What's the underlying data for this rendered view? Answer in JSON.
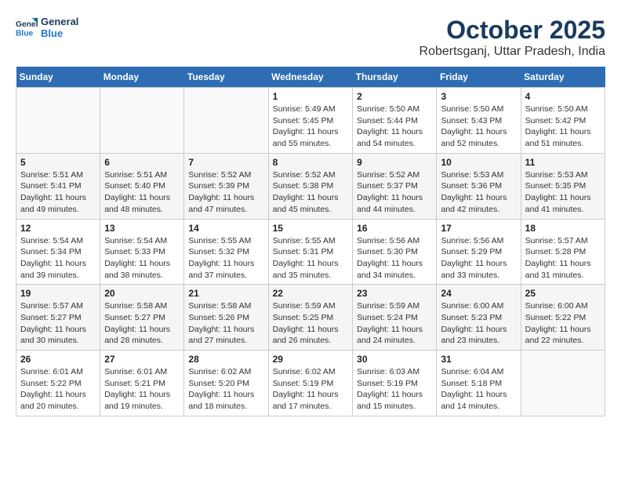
{
  "header": {
    "logo_line1": "General",
    "logo_line2": "Blue",
    "month": "October 2025",
    "location": "Robertsganj, Uttar Pradesh, India"
  },
  "weekdays": [
    "Sunday",
    "Monday",
    "Tuesday",
    "Wednesday",
    "Thursday",
    "Friday",
    "Saturday"
  ],
  "weeks": [
    [
      {
        "day": "",
        "info": ""
      },
      {
        "day": "",
        "info": ""
      },
      {
        "day": "",
        "info": ""
      },
      {
        "day": "1",
        "info": "Sunrise: 5:49 AM\nSunset: 5:45 PM\nDaylight: 11 hours\nand 55 minutes."
      },
      {
        "day": "2",
        "info": "Sunrise: 5:50 AM\nSunset: 5:44 PM\nDaylight: 11 hours\nand 54 minutes."
      },
      {
        "day": "3",
        "info": "Sunrise: 5:50 AM\nSunset: 5:43 PM\nDaylight: 11 hours\nand 52 minutes."
      },
      {
        "day": "4",
        "info": "Sunrise: 5:50 AM\nSunset: 5:42 PM\nDaylight: 11 hours\nand 51 minutes."
      }
    ],
    [
      {
        "day": "5",
        "info": "Sunrise: 5:51 AM\nSunset: 5:41 PM\nDaylight: 11 hours\nand 49 minutes."
      },
      {
        "day": "6",
        "info": "Sunrise: 5:51 AM\nSunset: 5:40 PM\nDaylight: 11 hours\nand 48 minutes."
      },
      {
        "day": "7",
        "info": "Sunrise: 5:52 AM\nSunset: 5:39 PM\nDaylight: 11 hours\nand 47 minutes."
      },
      {
        "day": "8",
        "info": "Sunrise: 5:52 AM\nSunset: 5:38 PM\nDaylight: 11 hours\nand 45 minutes."
      },
      {
        "day": "9",
        "info": "Sunrise: 5:52 AM\nSunset: 5:37 PM\nDaylight: 11 hours\nand 44 minutes."
      },
      {
        "day": "10",
        "info": "Sunrise: 5:53 AM\nSunset: 5:36 PM\nDaylight: 11 hours\nand 42 minutes."
      },
      {
        "day": "11",
        "info": "Sunrise: 5:53 AM\nSunset: 5:35 PM\nDaylight: 11 hours\nand 41 minutes."
      }
    ],
    [
      {
        "day": "12",
        "info": "Sunrise: 5:54 AM\nSunset: 5:34 PM\nDaylight: 11 hours\nand 39 minutes."
      },
      {
        "day": "13",
        "info": "Sunrise: 5:54 AM\nSunset: 5:33 PM\nDaylight: 11 hours\nand 38 minutes."
      },
      {
        "day": "14",
        "info": "Sunrise: 5:55 AM\nSunset: 5:32 PM\nDaylight: 11 hours\nand 37 minutes."
      },
      {
        "day": "15",
        "info": "Sunrise: 5:55 AM\nSunset: 5:31 PM\nDaylight: 11 hours\nand 35 minutes."
      },
      {
        "day": "16",
        "info": "Sunrise: 5:56 AM\nSunset: 5:30 PM\nDaylight: 11 hours\nand 34 minutes."
      },
      {
        "day": "17",
        "info": "Sunrise: 5:56 AM\nSunset: 5:29 PM\nDaylight: 11 hours\nand 33 minutes."
      },
      {
        "day": "18",
        "info": "Sunrise: 5:57 AM\nSunset: 5:28 PM\nDaylight: 11 hours\nand 31 minutes."
      }
    ],
    [
      {
        "day": "19",
        "info": "Sunrise: 5:57 AM\nSunset: 5:27 PM\nDaylight: 11 hours\nand 30 minutes."
      },
      {
        "day": "20",
        "info": "Sunrise: 5:58 AM\nSunset: 5:27 PM\nDaylight: 11 hours\nand 28 minutes."
      },
      {
        "day": "21",
        "info": "Sunrise: 5:58 AM\nSunset: 5:26 PM\nDaylight: 11 hours\nand 27 minutes."
      },
      {
        "day": "22",
        "info": "Sunrise: 5:59 AM\nSunset: 5:25 PM\nDaylight: 11 hours\nand 26 minutes."
      },
      {
        "day": "23",
        "info": "Sunrise: 5:59 AM\nSunset: 5:24 PM\nDaylight: 11 hours\nand 24 minutes."
      },
      {
        "day": "24",
        "info": "Sunrise: 6:00 AM\nSunset: 5:23 PM\nDaylight: 11 hours\nand 23 minutes."
      },
      {
        "day": "25",
        "info": "Sunrise: 6:00 AM\nSunset: 5:22 PM\nDaylight: 11 hours\nand 22 minutes."
      }
    ],
    [
      {
        "day": "26",
        "info": "Sunrise: 6:01 AM\nSunset: 5:22 PM\nDaylight: 11 hours\nand 20 minutes."
      },
      {
        "day": "27",
        "info": "Sunrise: 6:01 AM\nSunset: 5:21 PM\nDaylight: 11 hours\nand 19 minutes."
      },
      {
        "day": "28",
        "info": "Sunrise: 6:02 AM\nSunset: 5:20 PM\nDaylight: 11 hours\nand 18 minutes."
      },
      {
        "day": "29",
        "info": "Sunrise: 6:02 AM\nSunset: 5:19 PM\nDaylight: 11 hours\nand 17 minutes."
      },
      {
        "day": "30",
        "info": "Sunrise: 6:03 AM\nSunset: 5:19 PM\nDaylight: 11 hours\nand 15 minutes."
      },
      {
        "day": "31",
        "info": "Sunrise: 6:04 AM\nSunset: 5:18 PM\nDaylight: 11 hours\nand 14 minutes."
      },
      {
        "day": "",
        "info": ""
      }
    ]
  ]
}
